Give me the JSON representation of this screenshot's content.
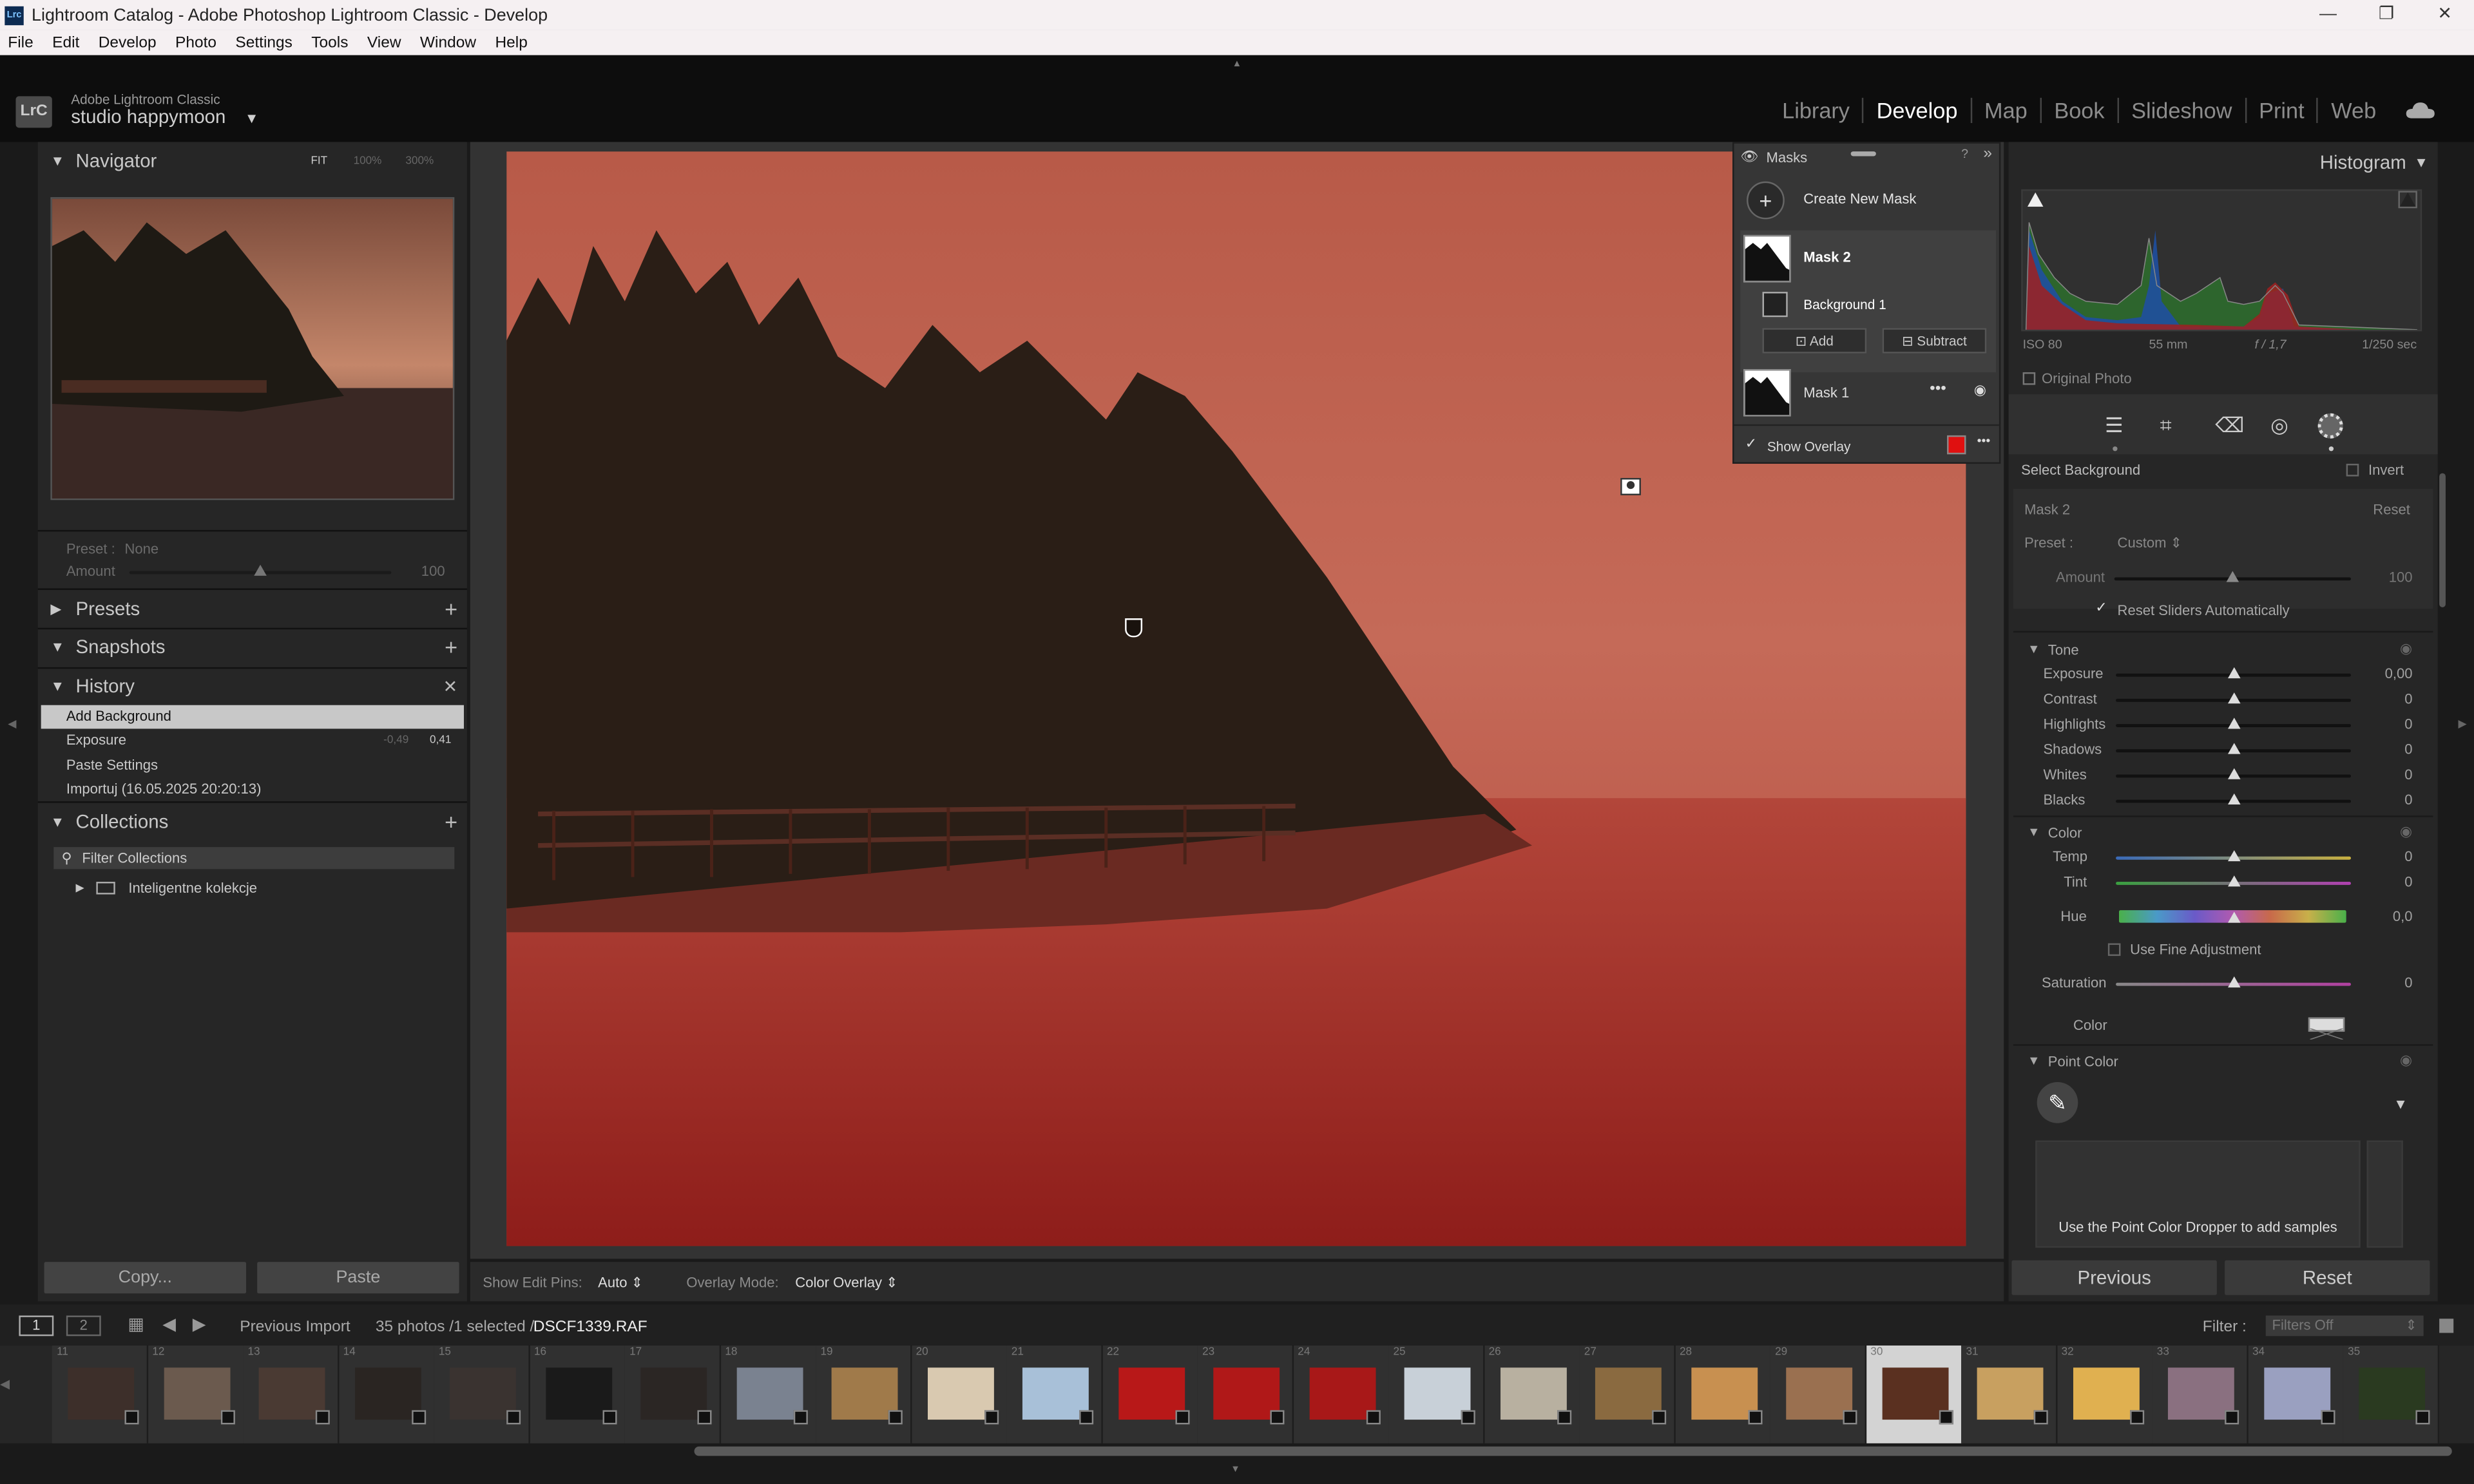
{
  "window": {
    "title": "Lightroom Catalog - Adobe Photoshop Lightroom Classic - Develop",
    "app_icon": "Lrc",
    "controls": [
      "—",
      "❐",
      "✕"
    ]
  },
  "menu": [
    "File",
    "Edit",
    "Develop",
    "Photo",
    "Settings",
    "Tools",
    "View",
    "Window",
    "Help"
  ],
  "brand": {
    "logo": "LrC",
    "line1": "Adobe Lightroom Classic",
    "line2": "studio happymoon"
  },
  "modules": {
    "items": [
      "Library",
      "Develop",
      "Map",
      "Book",
      "Slideshow",
      "Print",
      "Web"
    ],
    "active": "Develop"
  },
  "navigator": {
    "title": "Navigator",
    "fit": "FIT",
    "z1": "100%",
    "z2": "300%",
    "preset_label": "Preset :",
    "preset_value": "None",
    "amount_label": "Amount",
    "amount_value": "100"
  },
  "presets": {
    "title": "Presets"
  },
  "snapshots": {
    "title": "Snapshots"
  },
  "history": {
    "title": "History",
    "items": [
      {
        "label": "Add Background",
        "v1": "",
        "v2": ""
      },
      {
        "label": "Exposure",
        "v1": "-0,49",
        "v2": "0,41"
      },
      {
        "label": "Paste Settings",
        "v1": "",
        "v2": ""
      },
      {
        "label": "Importuj (16.05.2025 20:20:13)",
        "v1": "",
        "v2": ""
      }
    ]
  },
  "collections": {
    "title": "Collections",
    "filter": "Filter Collections",
    "item": "Inteligentne kolekcje"
  },
  "left_buttons": {
    "copy": "Copy...",
    "paste": "Paste"
  },
  "toolbar": {
    "pins_label": "Show Edit Pins:",
    "pins_value": "Auto",
    "overlay_label": "Overlay Mode:",
    "overlay_value": "Color Overlay"
  },
  "masks": {
    "title": "Masks",
    "create": "Create New Mask",
    "mask2": "Mask 2",
    "background1": "Background 1",
    "add": "Add",
    "subtract": "Subtract",
    "mask1": "Mask 1",
    "show_overlay": "Show Overlay",
    "overlay_color": "#e01010"
  },
  "histogram": {
    "title": "Histogram",
    "iso": "ISO 80",
    "focal": "55 mm",
    "aperture": "f / 1,7",
    "shutter": "1/250 sec",
    "original": "Original Photo"
  },
  "mask_panel": {
    "select": "Select Background",
    "invert": "Invert",
    "mask_name": "Mask 2",
    "reset": "Reset",
    "preset_label": "Preset :",
    "preset_value": "Custom",
    "amount_label": "Amount",
    "amount_value": "100",
    "reset_sliders": "Reset Sliders Automatically"
  },
  "tone": {
    "title": "Tone",
    "sliders": [
      {
        "label": "Exposure",
        "value": "0,00"
      },
      {
        "label": "Contrast",
        "value": "0"
      },
      {
        "label": "Highlights",
        "value": "0"
      },
      {
        "label": "Shadows",
        "value": "0"
      },
      {
        "label": "Whites",
        "value": "0"
      },
      {
        "label": "Blacks",
        "value": "0"
      }
    ]
  },
  "color": {
    "title": "Color",
    "temp": "Temp",
    "temp_v": "0",
    "tint": "Tint",
    "tint_v": "0",
    "hue": "Hue",
    "hue_v": "0,0",
    "fine": "Use Fine Adjustment",
    "sat": "Saturation",
    "sat_v": "0",
    "color": "Color"
  },
  "point_color": {
    "title": "Point Color",
    "hint": "Use the Point Color Dropper to add samples"
  },
  "right_buttons": {
    "previous": "Previous",
    "reset": "Reset"
  },
  "filmbar": {
    "view1": "1",
    "view2": "2",
    "source": "Previous Import",
    "count": "35 photos /1 selected /",
    "file": "DSCF1339.RAF",
    "filter_label": "Filter :",
    "filter_value": "Filters Off"
  },
  "film": [
    {
      "n": "11",
      "c": "#3d2f2a"
    },
    {
      "n": "12",
      "c": "#6b5a4e"
    },
    {
      "n": "13",
      "c": "#4a3a33"
    },
    {
      "n": "14",
      "c": "#2a2522"
    },
    {
      "n": "15",
      "c": "#3a3330"
    },
    {
      "n": "16",
      "c": "#1a1a1a"
    },
    {
      "n": "17",
      "c": "#2b2624"
    },
    {
      "n": "18",
      "c": "#7a8290"
    },
    {
      "n": "19",
      "c": "#a07a4a"
    },
    {
      "n": "20",
      "c": "#d9c9b0"
    },
    {
      "n": "21",
      "c": "#a8c0d8"
    },
    {
      "n": "22",
      "c": "#b81818"
    },
    {
      "n": "23",
      "c": "#b01818"
    },
    {
      "n": "24",
      "c": "#a81818"
    },
    {
      "n": "25",
      "c": "#c8d0d8"
    },
    {
      "n": "26",
      "c": "#b8b0a0"
    },
    {
      "n": "27",
      "c": "#8a6a40"
    },
    {
      "n": "28",
      "c": "#c89050"
    },
    {
      "n": "29",
      "c": "#9a7050"
    },
    {
      "n": "30",
      "c": "#5a3020"
    },
    {
      "n": "31",
      "c": "#c8a060"
    },
    {
      "n": "32",
      "c": "#e0b050"
    },
    {
      "n": "33",
      "c": "#8a7080"
    },
    {
      "n": "34",
      "c": "#9aa0c0"
    },
    {
      "n": "35",
      "c": "#2a3a20"
    }
  ]
}
